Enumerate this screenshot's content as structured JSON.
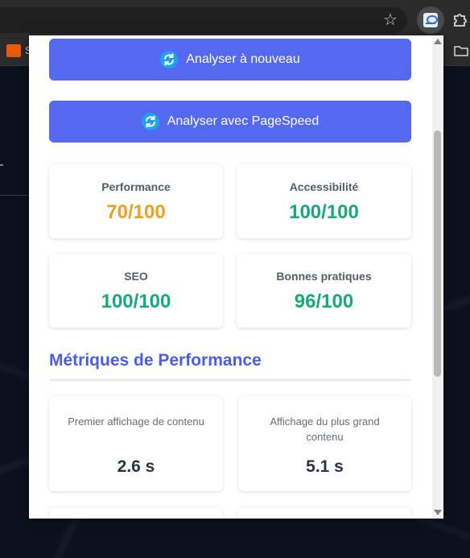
{
  "browser": {
    "bookmark_label": "S"
  },
  "actions": {
    "reanalyze_label": "Analyser à nouveau",
    "pagespeed_label": "Analyser avec PageSpeed"
  },
  "scores": [
    {
      "label": "Performance",
      "value": "70/100",
      "color": "#e8a320"
    },
    {
      "label": "Accessibilité",
      "value": "100/100",
      "color": "#18a97a"
    },
    {
      "label": "SEO",
      "value": "100/100",
      "color": "#18a97a"
    },
    {
      "label": "Bonnes pratiques",
      "value": "96/100",
      "color": "#18a97a"
    }
  ],
  "metrics_section": {
    "title": "Métriques de Performance",
    "items": [
      {
        "label": "Premier affichage de contenu",
        "value": "2.6 s"
      },
      {
        "label": "Affichage du plus grand contenu",
        "value": "5.1 s"
      }
    ]
  },
  "icons": {
    "refresh": "refresh-icon",
    "star": "star-icon",
    "extension": "extension-icon",
    "puzzle": "puzzle-icon",
    "folder": "folder-icon"
  },
  "colors": {
    "primary_button": "#5468f0",
    "section_title": "#4a5fe0",
    "score_warning": "#e8a320",
    "score_good": "#18a97a"
  }
}
